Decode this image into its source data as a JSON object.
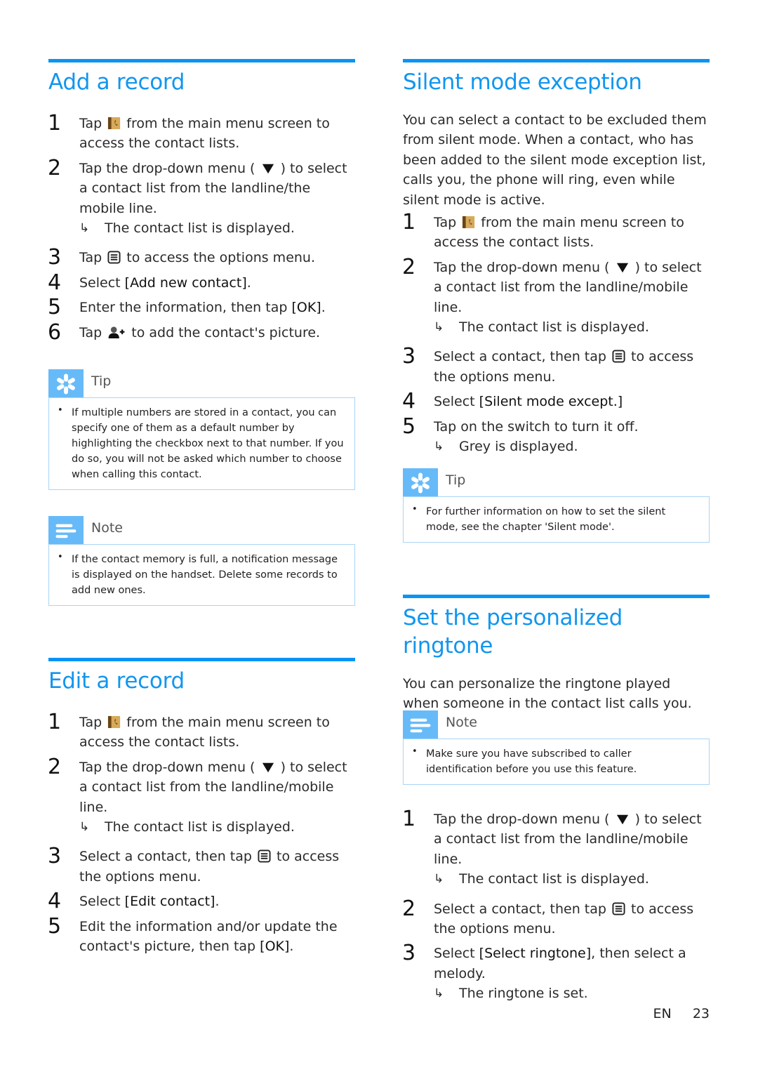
{
  "page": {
    "language": "EN",
    "number": "23"
  },
  "icons": {
    "contacts": "contacts-book-icon",
    "dropdown": "dropdown-triangle-icon",
    "options": "options-menu-icon",
    "add_picture": "add-contact-picture-icon",
    "tip": "tip-asterisk-icon",
    "note": "note-lines-icon",
    "result": "result-arrow-icon"
  },
  "colors": {
    "heading": "#1296ee",
    "rule": "#0a93f5",
    "badge": "#67baf8",
    "callout_border": "#a9d6f6"
  },
  "add_record": {
    "title": "Add a record",
    "steps": [
      {
        "num": "1",
        "pre": "Tap",
        "post": "from the main menu screen to access the contact lists."
      },
      {
        "num": "2",
        "pre": "Tap the drop-down menu (",
        "post": ") to select a contact list from the landline/the mobile line.",
        "result": "The contact list is displayed."
      },
      {
        "num": "3",
        "pre": "Tap",
        "post": "to access the options menu."
      },
      {
        "num": "4",
        "pre": "Select",
        "kw": "[Add new contact]",
        "post": "."
      },
      {
        "num": "5",
        "pre": "Enter the information, then tap",
        "kw": "[OK]",
        "post": "."
      },
      {
        "num": "6",
        "pre": "Tap",
        "post": "to add the contact's picture."
      }
    ],
    "tip": {
      "label": "Tip",
      "text": "If multiple numbers are stored in a contact, you can specify one of them as a default number by highlighting the checkbox next to that number. If you do so, you will not be asked which number to choose when calling this contact."
    },
    "note": {
      "label": "Note",
      "text": "If the contact memory is full, a notification message is displayed on the handset. Delete some records to add new ones."
    }
  },
  "edit_record": {
    "title": "Edit a record",
    "steps": [
      {
        "num": "1",
        "pre": "Tap",
        "post": "from the main menu screen to access the contact lists."
      },
      {
        "num": "2",
        "pre": "Tap the drop-down menu (",
        "post": ") to select a contact list from the landline/mobile line.",
        "result": "The contact list is displayed."
      },
      {
        "num": "3",
        "pre": "Select a contact, then tap",
        "post": "to access the options menu."
      },
      {
        "num": "4",
        "pre": "Select",
        "kw": "[Edit contact]",
        "post": "."
      },
      {
        "num": "5",
        "pre": "Edit the information and/or update the contact's picture, then tap",
        "kw": "[OK]",
        "post": "."
      }
    ]
  },
  "silent_mode": {
    "title": "Silent mode exception",
    "intro": "You can select a contact to be excluded them from silent mode. When a contact, who has been added to the silent mode exception list, calls you, the phone will ring, even while silent mode is active.",
    "steps": [
      {
        "num": "1",
        "pre": "Tap",
        "post": "from the main menu screen to access the contact lists."
      },
      {
        "num": "2",
        "pre": "Tap the drop-down menu (",
        "post": ") to select a contact list from the landline/mobile line.",
        "result": "The contact list is displayed."
      },
      {
        "num": "3",
        "pre": "Select a contact, then tap",
        "post": "to access the options menu."
      },
      {
        "num": "4",
        "pre": "Select",
        "kw": "[Silent mode except.]",
        "post": ""
      },
      {
        "num": "5",
        "pre": "Tap on the switch to turn it off.",
        "result": "Grey is displayed."
      }
    ],
    "tip": {
      "label": "Tip",
      "text": "For further information on how to set the silent mode, see the chapter 'Silent mode'."
    }
  },
  "ringtone": {
    "title": "Set the personalized ringtone",
    "intro": "You can personalize the ringtone played when someone in the contact list calls you.",
    "note": {
      "label": "Note",
      "text": "Make sure you have subscribed to caller identification before you use this feature."
    },
    "steps": [
      {
        "num": "1",
        "pre": "Tap the drop-down menu (",
        "post": ") to select a contact list from the landline/mobile line.",
        "result": "The contact list is displayed."
      },
      {
        "num": "2",
        "pre": "Select a contact, then tap",
        "post": "to access the options menu."
      },
      {
        "num": "3",
        "pre": "Select",
        "kw": "[Select ringtone]",
        "post": ", then select a melody.",
        "result": "The ringtone is set."
      }
    ]
  }
}
